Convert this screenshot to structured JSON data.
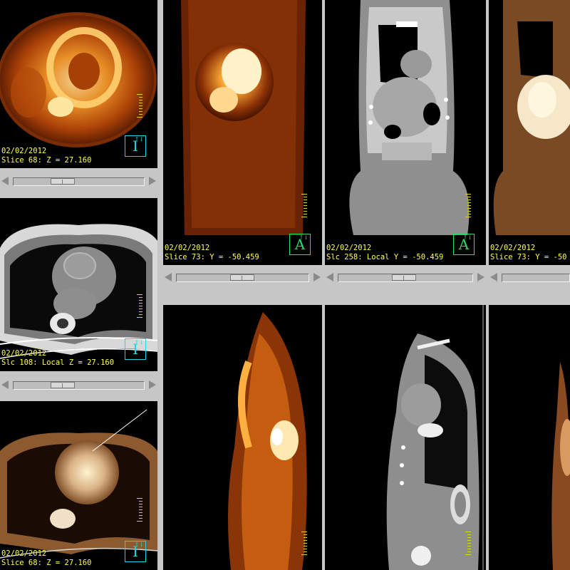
{
  "viewer": {
    "date": "02/02/2012",
    "colors": {
      "label": "#ffff55",
      "orient_cyan": "#22d3e3",
      "orient_green": "#22e06a",
      "ruler": "#e0d02a"
    },
    "viewports": {
      "pet_axial": {
        "label": "Slice 68: Z = 27.160",
        "orient": "I",
        "icon": "orientation-I-icon"
      },
      "ct_axial": {
        "label": "Slc 108: Local Z = 27.160",
        "orient": "I",
        "icon": "orientation-I-icon"
      },
      "fused_axial": {
        "label": "Slice 68: Z = 27.160",
        "orient": "I",
        "icon": "orientation-I-icon"
      },
      "pet_coronal": {
        "label": "Slice 73: Y = -50.459",
        "orient": "A",
        "icon": "orientation-A-icon"
      },
      "ct_coronal": {
        "label": "Slc 258: Local Y = -50.459",
        "orient": "A",
        "icon": "orientation-A-icon"
      },
      "fused_coronal": {
        "label": "Slice 73: Y = -50"
      },
      "pet_sagittal": {
        "label": ""
      },
      "ct_sagittal": {
        "label": ""
      }
    },
    "orient_super": "↑↓"
  }
}
